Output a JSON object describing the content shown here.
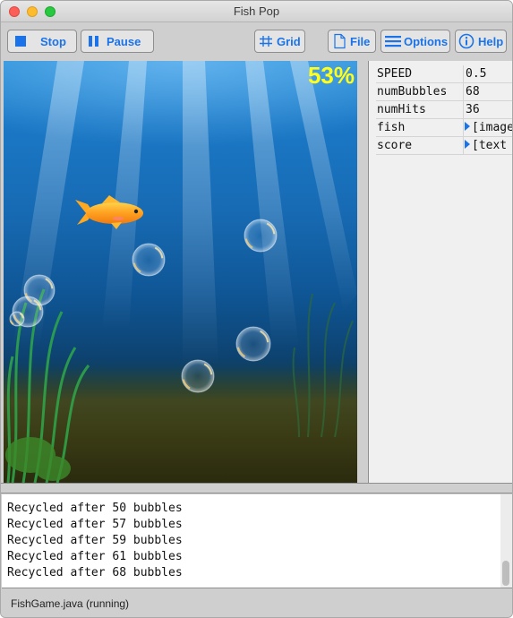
{
  "window": {
    "title": "Fish Pop"
  },
  "toolbar": {
    "stop": {
      "label": "Stop",
      "icon": "stop-icon"
    },
    "pause": {
      "label": "Pause",
      "icon": "pause-icon"
    },
    "grid": {
      "label": "Grid",
      "icon": "grid-icon"
    },
    "file": {
      "label": "File",
      "icon": "file-icon"
    },
    "options": {
      "label": "Options",
      "icon": "menu-icon"
    },
    "help": {
      "label": "Help",
      "icon": "info-icon"
    },
    "accent_color": "#1a73e8"
  },
  "game": {
    "score_text": "53%",
    "score_color": "#ffff1a",
    "fish": "goldfish",
    "bubble_count_visible": 7
  },
  "variables": {
    "rows": [
      {
        "name": "SPEED",
        "value": "0.5",
        "expandable": false
      },
      {
        "name": "numBubbles",
        "value": "68",
        "expandable": false
      },
      {
        "name": "numHits",
        "value": "36",
        "expandable": false
      },
      {
        "name": "fish",
        "value": "[image",
        "expandable": true
      },
      {
        "name": "score",
        "value": "[text",
        "expandable": true
      }
    ]
  },
  "console": {
    "lines": [
      "Recycled after 50 bubbles",
      "Recycled after 57 bubbles",
      "Recycled after 59 bubbles",
      "Recycled after 61 bubbles",
      "Recycled after 68 bubbles"
    ]
  },
  "status": {
    "text": "FishGame.java (running)"
  }
}
